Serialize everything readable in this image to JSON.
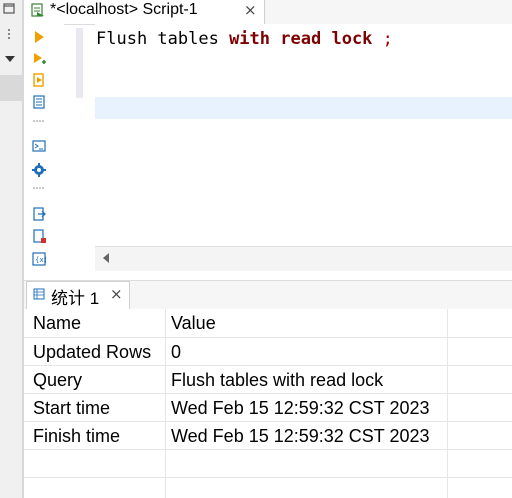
{
  "editor": {
    "tab_title": "*<localhost> Script-1",
    "tab_close": "×",
    "code": {
      "plain": "Flush tables ",
      "kw1": "with",
      "kw2": "read",
      "kw3": "lock",
      "semicolon": ";"
    }
  },
  "results": {
    "tab_label": "统计 1",
    "tab_close": "×",
    "columns": [
      "Name",
      "Value"
    ],
    "rows": [
      {
        "name": "Updated Rows",
        "value": "0"
      },
      {
        "name": "Query",
        "value": "Flush tables with read lock"
      },
      {
        "name": "Start time",
        "value": "Wed Feb 15 12:59:32 CST 2023"
      },
      {
        "name": "Finish time",
        "value": "Wed Feb 15 12:59:32 CST 2023"
      }
    ]
  },
  "icons": {
    "toolbar": [
      "execute-statement-icon",
      "execute-script-icon",
      "execute-file-icon",
      "explain-plan-icon",
      "console-icon",
      "settings-icon",
      "export-icon",
      "import-icon",
      "variables-icon"
    ],
    "accent_orange": "#f0a000",
    "accent_blue": "#1f6fb8"
  }
}
